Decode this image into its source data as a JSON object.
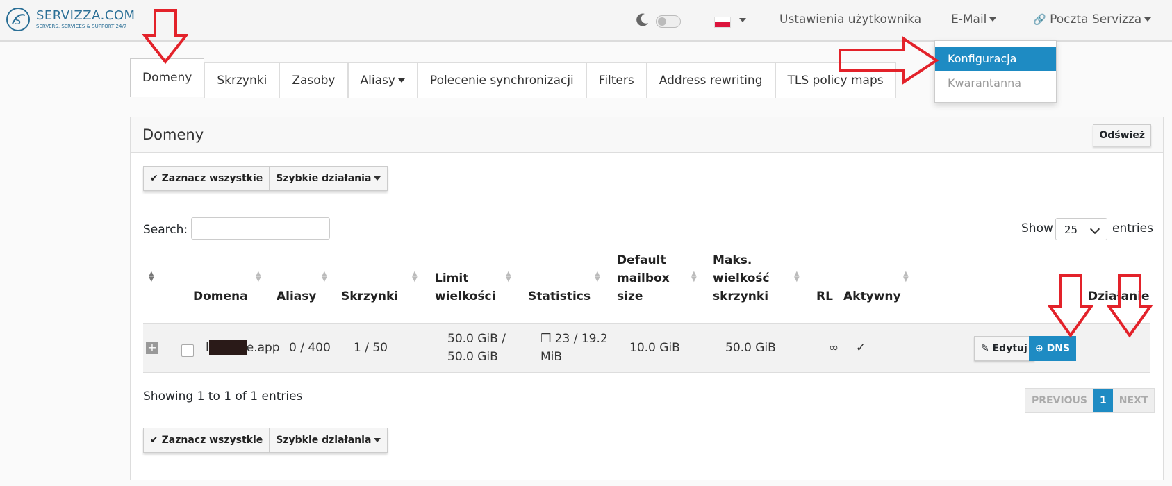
{
  "brand": {
    "title": "SERVIZZA.COM",
    "subtitle": "SERVERS, SERVICES & SUPPORT 24/7"
  },
  "nav": {
    "user_settings": "Ustawienia użytkownika",
    "email": "E-Mail",
    "mailbox": "Poczta Servizza"
  },
  "email_menu": {
    "items": [
      "Konfiguracja",
      "Kwarantanna"
    ]
  },
  "tabs": [
    "Domeny",
    "Skrzynki",
    "Zasoby",
    "Aliasy",
    "Polecenie synchronizacji",
    "Filters",
    "Address rewriting",
    "TLS policy maps"
  ],
  "panel": {
    "title": "Domeny",
    "refresh": "Odśwież"
  },
  "toolbar": {
    "select_all": "Zaznacz wszystkie",
    "quick_actions": "Szybkie działania"
  },
  "search": {
    "label": "Search:",
    "value": ""
  },
  "length": {
    "show": "Show",
    "value": "25",
    "entries": "entries"
  },
  "table": {
    "headers": [
      "Domena",
      "Aliasy",
      "Skrzynki",
      "Limit wielkości",
      "Statistics",
      "Default mailbox size",
      "Maks. wielkość skrzynki",
      "RL",
      "Aktywny",
      "Działanie"
    ],
    "row": {
      "domain_start": "l",
      "domain_end": "e.app",
      "aliases": "0 / 400",
      "mailboxes": "1 / 50",
      "limit": "50.0 GiB / 50.0 GiB",
      "statistics": "23 / 19.2 MiB",
      "default_size": "10.0 GiB",
      "max_size": "50.0 GiB",
      "rl": "∞",
      "active": "✓",
      "edit": "Edytuj",
      "dns": "DNS"
    }
  },
  "footer": {
    "info": "Showing 1 to 1 of 1 entries",
    "previous": "PREVIOUS",
    "page": "1",
    "next": "NEXT"
  },
  "colors": {
    "accent": "#1e8bc3",
    "annotation": "#e3222a"
  }
}
